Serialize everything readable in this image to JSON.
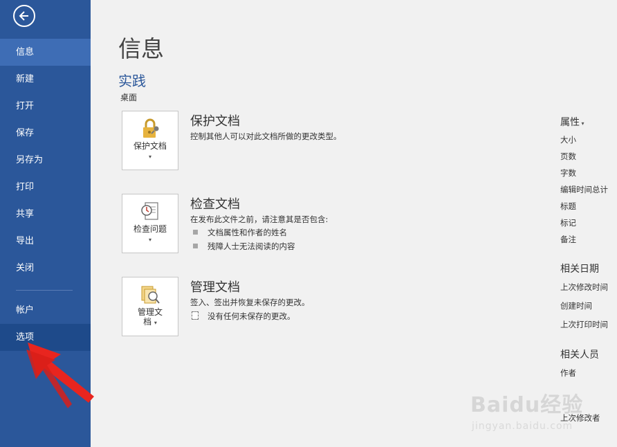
{
  "sidebar": {
    "items": [
      {
        "label": "信息"
      },
      {
        "label": "新建"
      },
      {
        "label": "打开"
      },
      {
        "label": "保存"
      },
      {
        "label": "另存为"
      },
      {
        "label": "打印"
      },
      {
        "label": "共享"
      },
      {
        "label": "导出"
      },
      {
        "label": "关闭"
      },
      {
        "label": "帐户"
      },
      {
        "label": "选项"
      }
    ],
    "active_index": 0,
    "highlighted_index": 10
  },
  "main": {
    "title": "信息",
    "document_name": "实践",
    "document_location": "桌面",
    "sections": [
      {
        "tile_label": "保护文档",
        "title": "保护文档",
        "description": "控制其他人可以对此文档所做的更改类型。"
      },
      {
        "tile_label": "检查问题",
        "title": "检查文档",
        "description": "在发布此文件之前，请注意其是否包含:",
        "bullets": [
          "文档属性和作者的姓名",
          "残障人士无法阅读的内容"
        ]
      },
      {
        "tile_label_line1": "管理文",
        "tile_label_line2": "档",
        "title": "管理文档",
        "description": "签入、签出并恢复未保存的更改。",
        "note": "没有任何未保存的更改。"
      }
    ]
  },
  "properties": {
    "header": "属性",
    "items": [
      "大小",
      "页数",
      "字数",
      "编辑时间总计",
      "标题",
      "标记",
      "备注"
    ],
    "dates_header": "相关日期",
    "dates": [
      "上次修改时间",
      "创建时间",
      "上次打印时间"
    ],
    "people_header": "相关人员",
    "people": [
      "作者",
      "上次修改者"
    ]
  },
  "watermark": {
    "text": "Baidu经验",
    "sub": "jingyan.baidu.com"
  },
  "colors": {
    "sidebar": "#2b579a",
    "active": "#3e6db5",
    "highlight": "#1e4a8a",
    "arrow": "#e8251f"
  }
}
